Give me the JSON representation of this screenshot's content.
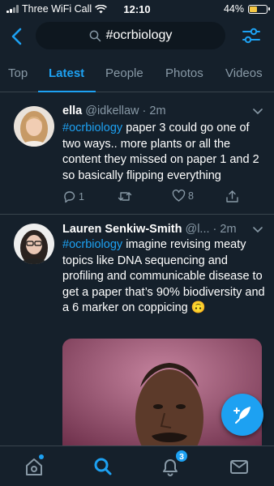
{
  "status_bar": {
    "carrier": "Three WiFi Call",
    "time": "12:10",
    "battery": "44%",
    "battery_level": 0.44
  },
  "search": {
    "query": "#ocrbiology"
  },
  "tabs": [
    {
      "label": "Top"
    },
    {
      "label": "Latest"
    },
    {
      "label": "People"
    },
    {
      "label": "Photos"
    },
    {
      "label": "Videos"
    }
  ],
  "active_tab": "Latest",
  "tweets": [
    {
      "name": "ella",
      "meta": "@idkellaw · 2m",
      "hashtag": "#ocrbiology",
      "text": " paper 3 could go one of two ways.. more plants or all the content they missed on paper 1 and 2 so basically flipping everything",
      "replies": "1",
      "retweets": "",
      "likes": "8"
    },
    {
      "name": "Lauren Senkiw-Smith",
      "meta": "@l... · 2m",
      "hashtag": "#ocrbiology",
      "text": " imagine revising meaty topics like DNA sequencing and profiling and communicable disease to get a paper that’s 90% biodiversity and a 6 marker on coppicing 🙃"
    }
  ],
  "bottom_nav": {
    "notifications_count": "3"
  },
  "colors": {
    "background": "#15202b",
    "accent": "#1da1f2",
    "muted": "#8899a6",
    "divider": "#38444d"
  }
}
